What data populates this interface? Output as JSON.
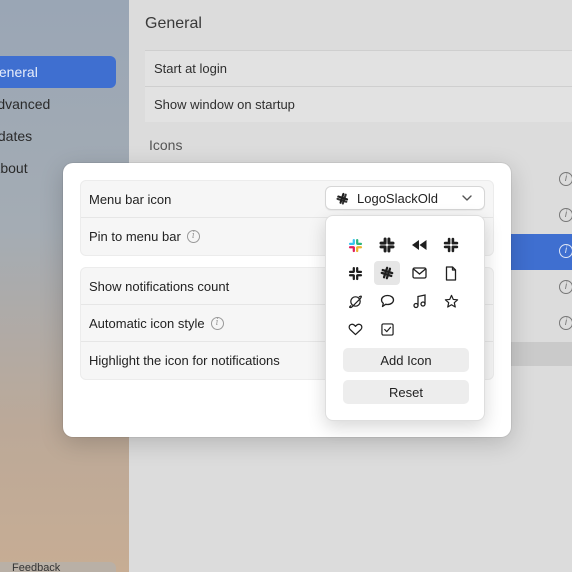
{
  "background": {
    "sidebar": {
      "items": [
        {
          "label": "General",
          "active": true
        },
        {
          "label": "Advanced",
          "active": false
        },
        {
          "label": "Updates",
          "active": false
        },
        {
          "label": "About",
          "active": false
        }
      ],
      "feedback_label": "Feedback"
    },
    "main": {
      "title": "General",
      "rows": [
        "Start at login",
        "Show window on startup"
      ],
      "icons_section_label": "Icons"
    }
  },
  "dialog": {
    "group1": {
      "menu_bar_icon_label": "Menu bar icon",
      "pin_label": "Pin to menu bar"
    },
    "group2": {
      "show_count_label": "Show notifications count",
      "auto_style_label": "Automatic icon style",
      "highlight_label": "Highlight the icon for notifications"
    },
    "select": {
      "value": "LogoSlackOld",
      "icon": "slack-old-icon"
    },
    "menu": {
      "icons": [
        {
          "name": "slack-color-icon",
          "selected": false
        },
        {
          "name": "slack-bold-icon",
          "selected": false
        },
        {
          "name": "rewind-icon",
          "selected": false
        },
        {
          "name": "slack-outline-icon",
          "selected": false
        },
        {
          "name": "slack-thin-icon",
          "selected": false
        },
        {
          "name": "slack-old-icon",
          "selected": true
        },
        {
          "name": "envelope-icon",
          "selected": false
        },
        {
          "name": "document-icon",
          "selected": false
        },
        {
          "name": "planet-icon",
          "selected": false
        },
        {
          "name": "speech-bubble-icon",
          "selected": false
        },
        {
          "name": "music-note-icon",
          "selected": false
        },
        {
          "name": "star-icon",
          "selected": false
        },
        {
          "name": "heart-icon",
          "selected": false
        },
        {
          "name": "checkbox-icon",
          "selected": false
        }
      ],
      "add_icon_label": "Add Icon",
      "reset_label": "Reset"
    }
  },
  "colors": {
    "accent": "#3f6fd0",
    "slack_red": "#e01e5a",
    "slack_blue": "#36c5f0",
    "slack_green": "#2eb67d",
    "slack_yellow": "#ecb22e"
  }
}
